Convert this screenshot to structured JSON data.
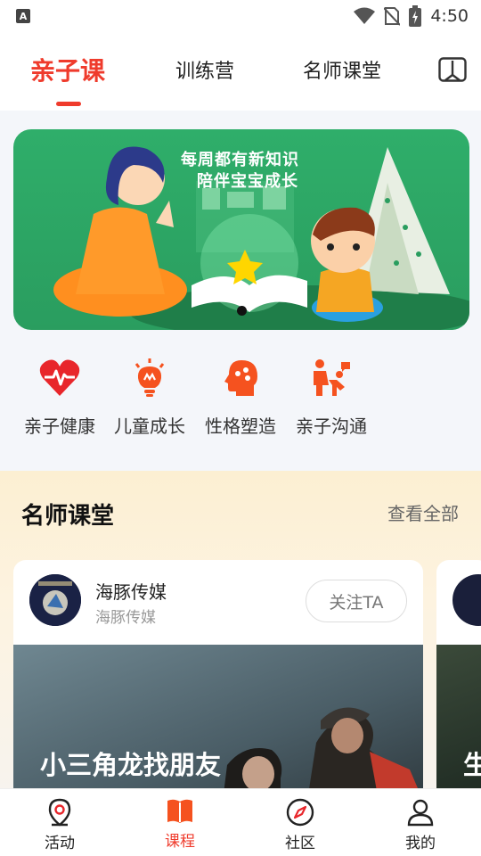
{
  "status_bar": {
    "time": "4:50",
    "app_icon": "A"
  },
  "top_tabs": [
    {
      "label": "亲子课",
      "active": true
    },
    {
      "label": "训练营",
      "active": false
    },
    {
      "label": "名师课堂",
      "active": false
    }
  ],
  "banner": {
    "line1": "每周都有新知识",
    "line2": "陪伴宝宝成长"
  },
  "categories": [
    {
      "label": "亲子健康",
      "icon": "heart-pulse-icon"
    },
    {
      "label": "儿童成长",
      "icon": "lightbulb-icon"
    },
    {
      "label": "性格塑造",
      "icon": "head-icon"
    },
    {
      "label": "亲子沟通",
      "icon": "parent-child-icon"
    }
  ],
  "section": {
    "title": "名师课堂",
    "more": "查看全部",
    "card": {
      "name": "海豚传媒",
      "sub": "海豚传媒",
      "follow": "关注TA",
      "image_title": "小三角龙找朋友"
    },
    "peek_text": "生"
  },
  "bottom_nav": [
    {
      "label": "活动",
      "icon": "location-pin-icon",
      "active": false
    },
    {
      "label": "课程",
      "icon": "book-icon",
      "active": true
    },
    {
      "label": "社区",
      "icon": "compass-icon",
      "active": false
    },
    {
      "label": "我的",
      "icon": "person-icon",
      "active": false
    }
  ],
  "colors": {
    "accent": "#ef3b2c",
    "icon_orange": "#f5521f",
    "banner_green": "#2fae6a"
  }
}
